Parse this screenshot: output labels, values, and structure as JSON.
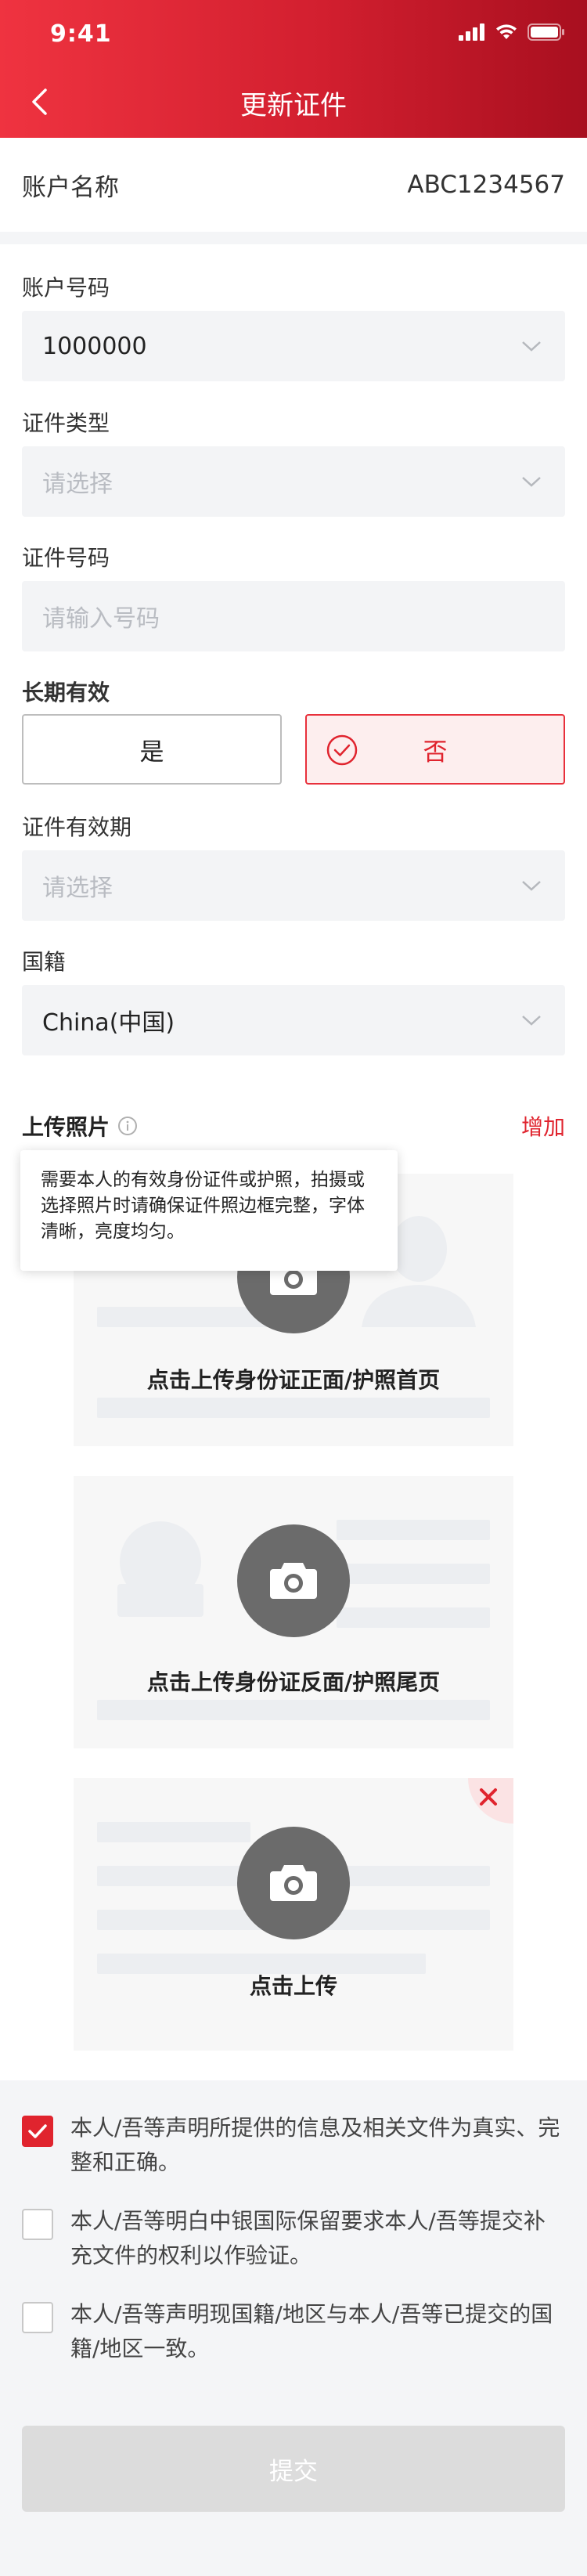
{
  "status_bar": {
    "time": "9:41"
  },
  "nav": {
    "title": "更新证件"
  },
  "account": {
    "name_label": "账户名称",
    "name_value": "ABC1234567"
  },
  "form": {
    "account_no": {
      "label": "账户号码",
      "value": "1000000"
    },
    "id_type": {
      "label": "证件类型",
      "placeholder": "请选择"
    },
    "id_number": {
      "label": "证件号码",
      "placeholder": "请输入号码"
    },
    "long_term": {
      "label": "长期有效",
      "yes": "是",
      "no": "否",
      "selected": "否"
    },
    "validity": {
      "label": "证件有效期",
      "placeholder": "请选择"
    },
    "nationality": {
      "label": "国籍",
      "value": "China(中国)"
    }
  },
  "upload": {
    "title": "上传照片",
    "add_label": "增加",
    "tooltip": "需要本人的有效身份证件或护照，拍摄或选择照片时请确保证件照边框完整，字体清晰，亮度均匀。",
    "cards": [
      {
        "label": "点击上传身份证正面/护照首页"
      },
      {
        "label": "点击上传身份证反面/护照尾页"
      },
      {
        "label": "点击上传"
      }
    ]
  },
  "declarations": [
    {
      "text": "本人/吾等声明所提供的信息及相关文件为真实、完整和正确。",
      "checked": true
    },
    {
      "text": "本人/吾等明白中银国际保留要求本人/吾等提交补充文件的权利以作验证。",
      "checked": false
    },
    {
      "text": "本人/吾等声明现国籍/地区与本人/吾等已提交的国籍/地区一致。",
      "checked": false
    }
  ],
  "submit_label": "提交",
  "colors": {
    "brand_red": "#e0242e",
    "header_start": "#ef3340",
    "header_end": "#a80f1f"
  }
}
